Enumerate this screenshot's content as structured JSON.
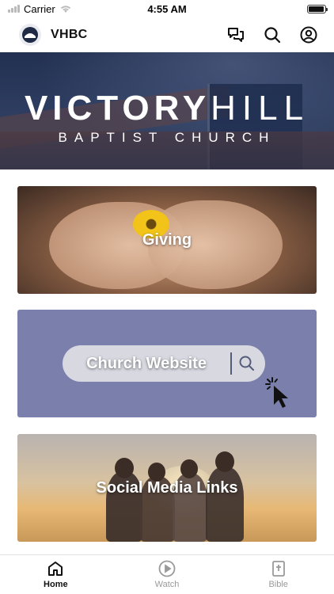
{
  "status_bar": {
    "carrier": "Carrier",
    "time": "4:55 AM",
    "battery_level": 0.95
  },
  "header": {
    "app_title": "VHBC",
    "icons": [
      "chat-icon",
      "search-icon",
      "account-icon"
    ]
  },
  "hero": {
    "line1_bold": "VICTORY",
    "line1_thin": "HILL",
    "line2": "BAPTIST CHURCH"
  },
  "cards": [
    {
      "label": "Giving"
    },
    {
      "label": "Church Website"
    },
    {
      "label": "Social Media Links"
    }
  ],
  "tabbar": {
    "tabs": [
      {
        "label": "Home",
        "icon": "home-icon",
        "active": true
      },
      {
        "label": "Watch",
        "icon": "play-icon",
        "active": false
      },
      {
        "label": "Bible",
        "icon": "bible-icon",
        "active": false
      }
    ]
  },
  "colors": {
    "accent": "#1f2a44",
    "inactive": "#9a9a9a",
    "website_card": "#7a80ab"
  }
}
